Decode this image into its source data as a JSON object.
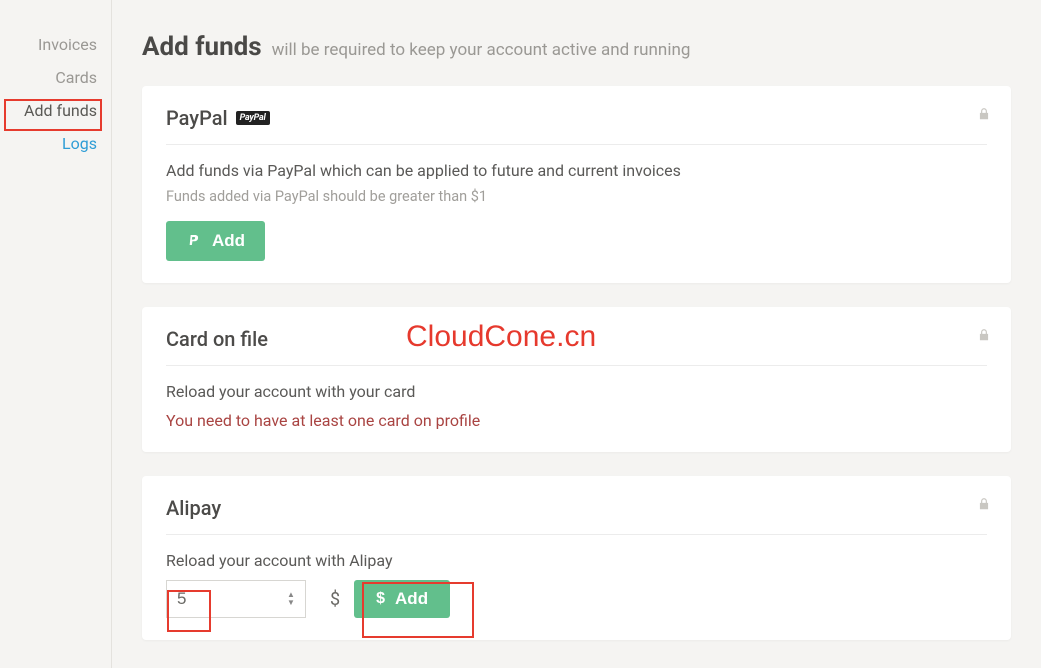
{
  "sidebar": {
    "items": [
      {
        "label": "Invoices"
      },
      {
        "label": "Cards"
      },
      {
        "label": "Add funds"
      },
      {
        "label": "Logs"
      }
    ]
  },
  "page": {
    "title": "Add funds",
    "subtitle": "will be required to keep your account active and running"
  },
  "paypal": {
    "title": "PayPal",
    "badge": "PayPal",
    "desc": "Add funds via PayPal which can be applied to future and current invoices",
    "sub": "Funds added via PayPal should be greater than $1",
    "button": "Add"
  },
  "cardfile": {
    "title": "Card on file",
    "desc": "Reload your account with your card",
    "warn": "You need to have at least one card on profile"
  },
  "alipay": {
    "title": "Alipay",
    "desc": "Reload your account with Alipay",
    "amount": "5",
    "currency": "$",
    "button": "Add"
  },
  "watermark": "CloudCone.cn"
}
